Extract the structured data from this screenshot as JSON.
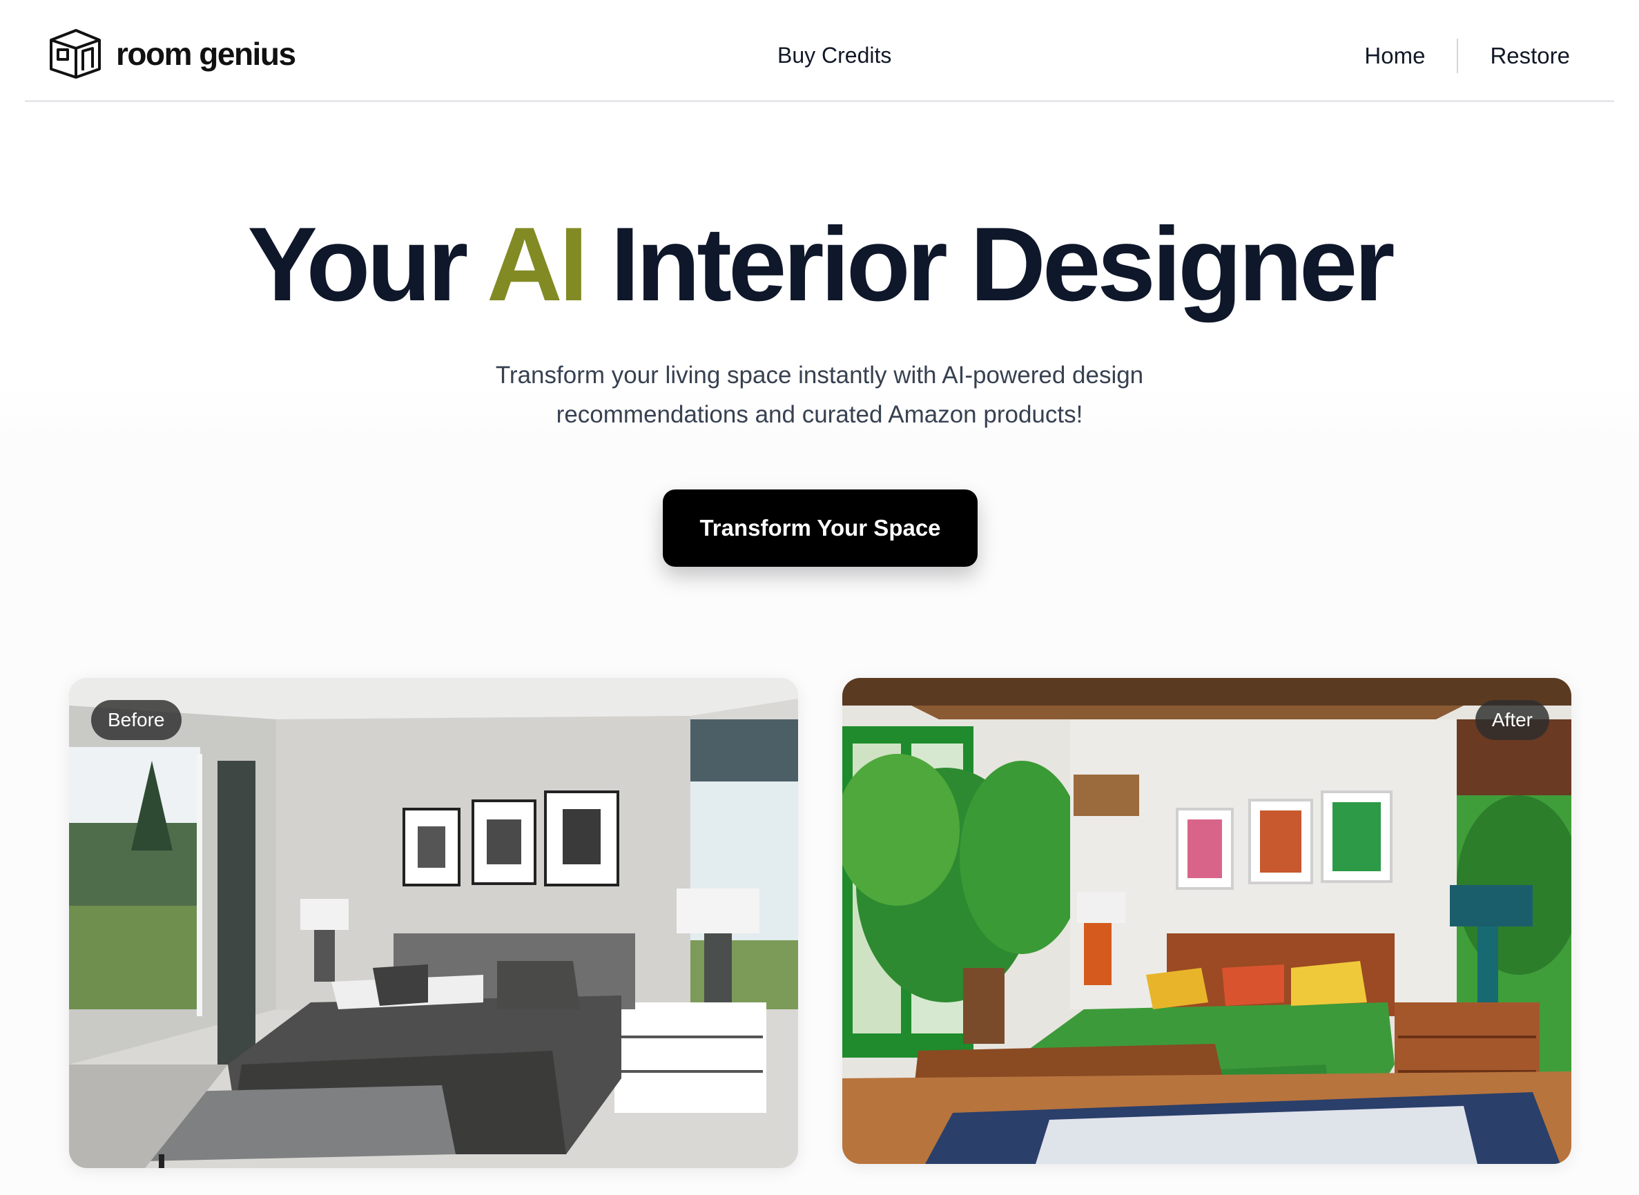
{
  "header": {
    "logo_text": "room genius",
    "nav_center": "Buy Credits",
    "nav_home": "Home",
    "nav_restore": "Restore"
  },
  "hero": {
    "title_part1": "Your",
    "title_ai": "AI",
    "title_part2": "Interior Designer",
    "subtitle_line1": "Transform your living space instantly with AI-powered design",
    "subtitle_line2": "recommendations and curated Amazon products!",
    "cta_label": "Transform Your Space"
  },
  "gallery": {
    "before_label": "Before",
    "after_label": "After"
  },
  "colors": {
    "accent": "#828a24",
    "text_dark": "#0f172a",
    "button_bg": "#000000"
  }
}
